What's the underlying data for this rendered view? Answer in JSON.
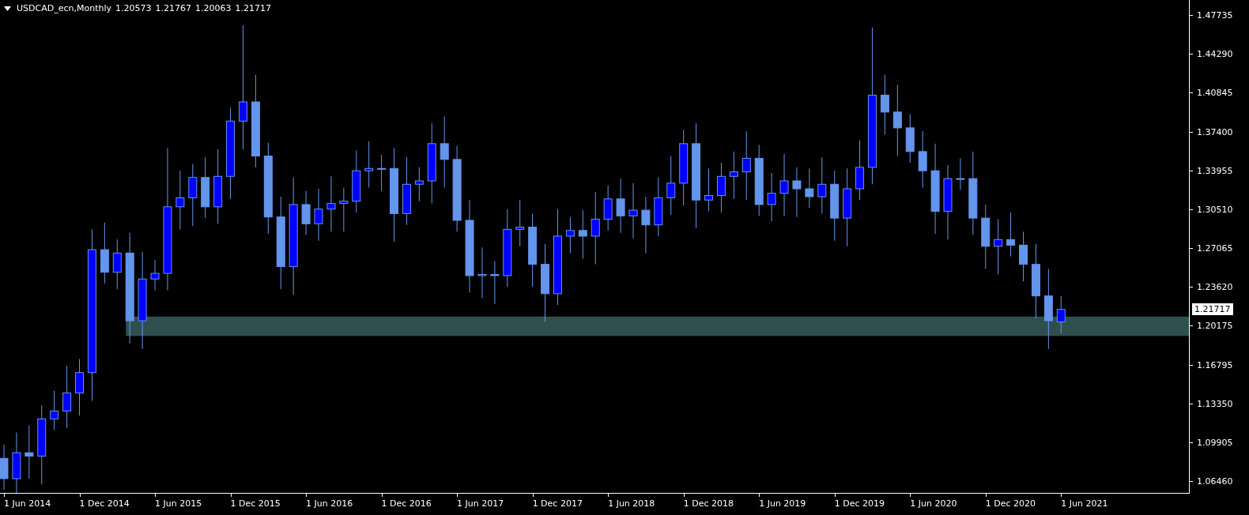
{
  "chart_header": {
    "symbol_period": "USDCAD_ecn,Monthly",
    "ohlc": [
      "1.20573",
      "1.21767",
      "1.20063",
      "1.21717"
    ]
  },
  "price_axis": {
    "labels": [
      "1.47735",
      "1.44290",
      "1.40845",
      "1.37400",
      "1.33955",
      "1.30510",
      "1.27065",
      "1.23620",
      "1.20175",
      "1.16795",
      "1.13350",
      "1.09905",
      "1.06460"
    ],
    "current_price": "1.21717"
  },
  "time_axis": {
    "labels": [
      "1 Jun 2014",
      "1 Dec 2014",
      "1 Jun 2015",
      "1 Dec 2015",
      "1 Jun 2016",
      "1 Dec 2016",
      "1 Jun 2017",
      "1 Dec 2017",
      "1 Jun 2018",
      "1 Dec 2018",
      "1 Jun 2019",
      "1 Dec 2019",
      "1 Jun 2020",
      "1 Dec 2020",
      "1 Jun 2021"
    ]
  }
}
